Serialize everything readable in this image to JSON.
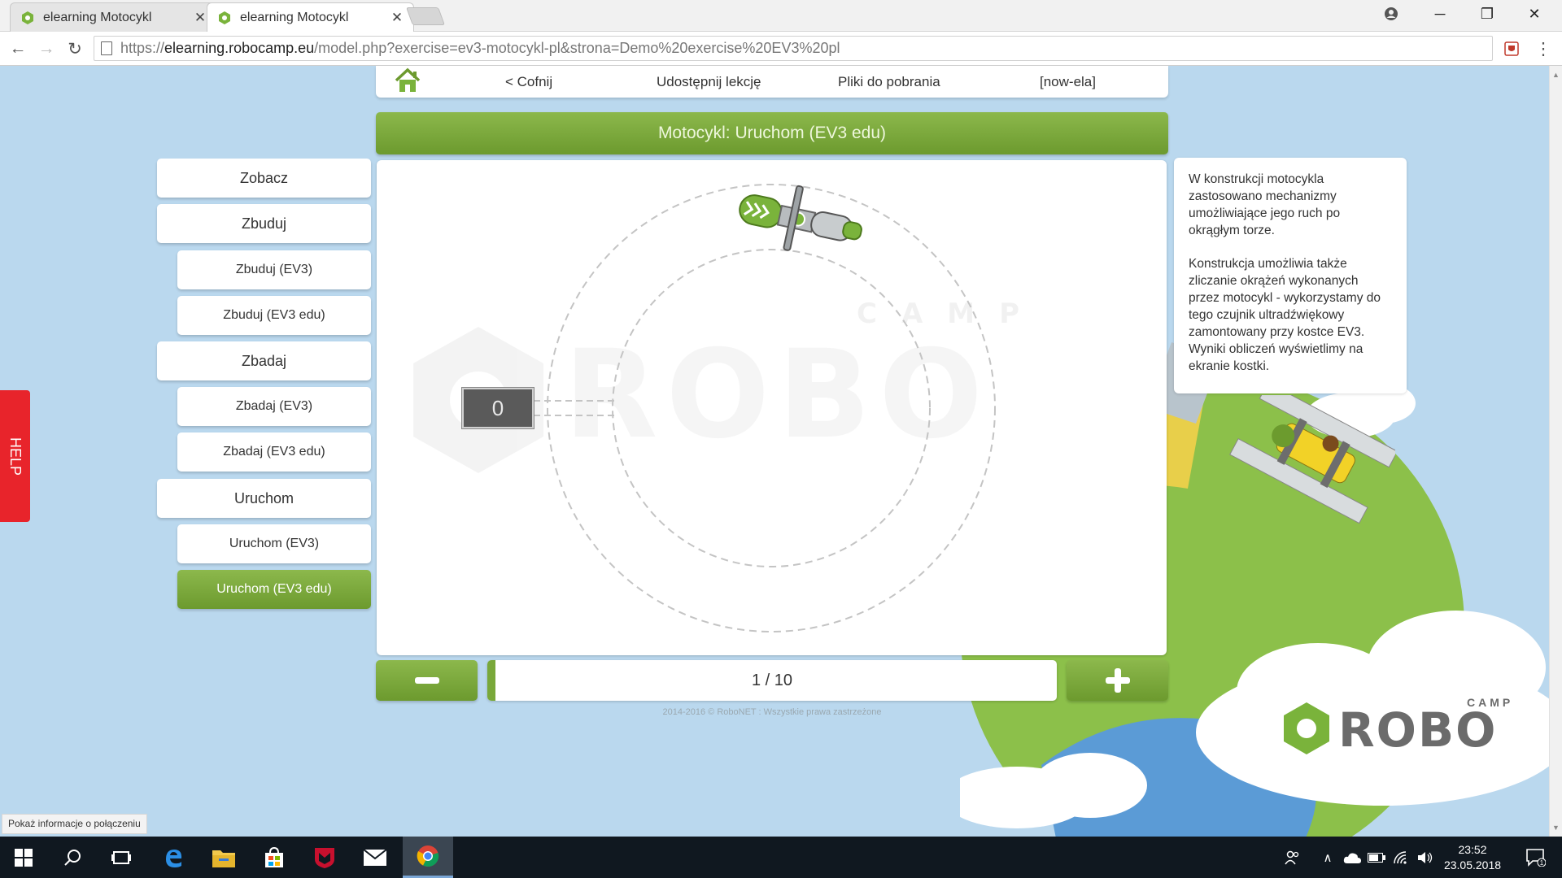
{
  "browser": {
    "tabs": [
      {
        "title": "elearning Motocykl",
        "active": false
      },
      {
        "title": "elearning Motocykl",
        "active": true
      }
    ],
    "url_scheme": "https://",
    "url_host": "elearning.robocamp.eu",
    "url_path": "/model.php?exercise=ev3-motocykl-pl&strona=Demo%20exercise%20EV3%20pl"
  },
  "topnav": {
    "back": "< Cofnij",
    "share": "Udostępnij lekcję",
    "downloads": "Pliki do pobrania",
    "user": "[now-ela]"
  },
  "header_title": "Motocykl: Uruchom (EV3 edu)",
  "sidebar": [
    {
      "label": "Zobacz",
      "level": 1,
      "active": false
    },
    {
      "label": "Zbuduj",
      "level": 1,
      "active": false
    },
    {
      "label": "Zbuduj (EV3)",
      "level": 2,
      "active": false
    },
    {
      "label": "Zbuduj (EV3 edu)",
      "level": 2,
      "active": false
    },
    {
      "label": "Zbadaj",
      "level": 1,
      "active": false
    },
    {
      "label": "Zbadaj (EV3)",
      "level": 2,
      "active": false
    },
    {
      "label": "Zbadaj (EV3 edu)",
      "level": 2,
      "active": false
    },
    {
      "label": "Uruchom",
      "level": 1,
      "active": false
    },
    {
      "label": "Uruchom (EV3)",
      "level": 2,
      "active": false
    },
    {
      "label": "Uruchom (EV3 edu)",
      "level": 2,
      "active": true
    }
  ],
  "stage": {
    "counter_value": "0",
    "watermark_camp": "CAMP",
    "watermark_robo": "ROBO"
  },
  "info": {
    "p1": "W konstrukcji motocykla zastosowano mechanizmy umożliwiające jego ruch po okrągłym torze.",
    "p2": "Konstrukcja umożliwia także zliczanie okrążeń wykonanych przez motocykl - wykorzystamy do tego czujnik ultradźwiękowy zamontowany przy kostce EV3. Wyniki obliczeń wyświetlimy na ekranie kostki."
  },
  "pager": {
    "label": "1 / 10",
    "fraction": 0.1
  },
  "copyright": "2014-2016 © RoboNET : Wszystkie prawa zastrzeżone",
  "help_label": "HELP",
  "status_tip": "Pokaż informacje o połączeniu",
  "logo": {
    "camp": "CAMP",
    "robo": "ROBO"
  },
  "taskbar": {
    "time": "23:52",
    "date": "23.05.2018",
    "notification_count": "1"
  },
  "colors": {
    "accent_green": "#7aa93a",
    "help_red": "#e8242b",
    "page_bg": "#bad8ee"
  },
  "icons": [
    "home-icon",
    "minus-icon",
    "plus-icon",
    "motorcycle-icon",
    "windows-start-icon",
    "search-icon",
    "task-view-icon",
    "edge-icon",
    "file-explorer-icon",
    "store-icon",
    "mcafee-icon",
    "mail-icon",
    "chrome-icon"
  ]
}
